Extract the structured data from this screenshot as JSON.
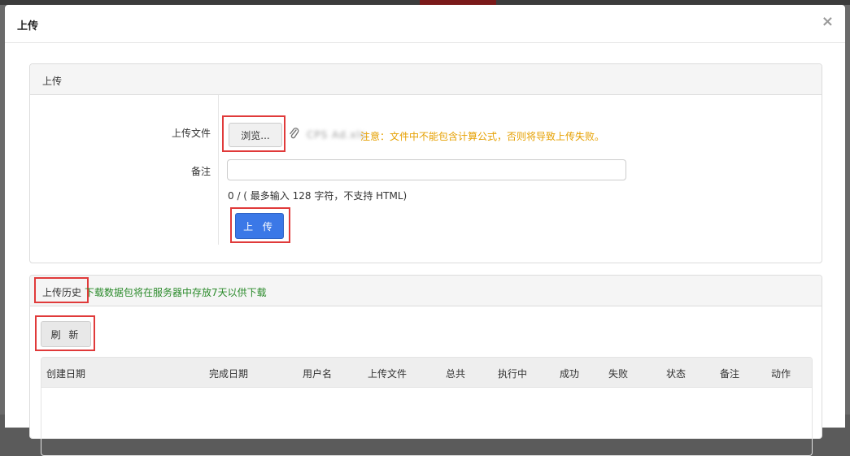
{
  "modal": {
    "title": "上传",
    "close": "×"
  },
  "upload_panel": {
    "heading": "上传",
    "file_label": "上传文件",
    "browse_label": "浏览...",
    "filename": "CPS Ad.xls",
    "warning": "注意：文件中不能包含计算公式，否则将导致上传失败。",
    "note_label": "备注",
    "note_value": "",
    "note_hint": "0 / ( 最多输入 128 字符，不支持 HTML)",
    "upload_button": "上 传"
  },
  "history_panel": {
    "heading": "上传历史",
    "note": "下载数据包将在服务器中存放7天以供下载",
    "refresh_button": "刷 新",
    "columns": [
      "创建日期",
      "完成日期",
      "用户名",
      "上传文件",
      "总共",
      "执行中",
      "成功",
      "失败",
      "状态",
      "备注",
      "动作"
    ]
  },
  "colors": {
    "primary": "#3b78e7",
    "warning": "#e6a000",
    "success": "#2a8a2a",
    "highlight": "#e03a3a"
  }
}
